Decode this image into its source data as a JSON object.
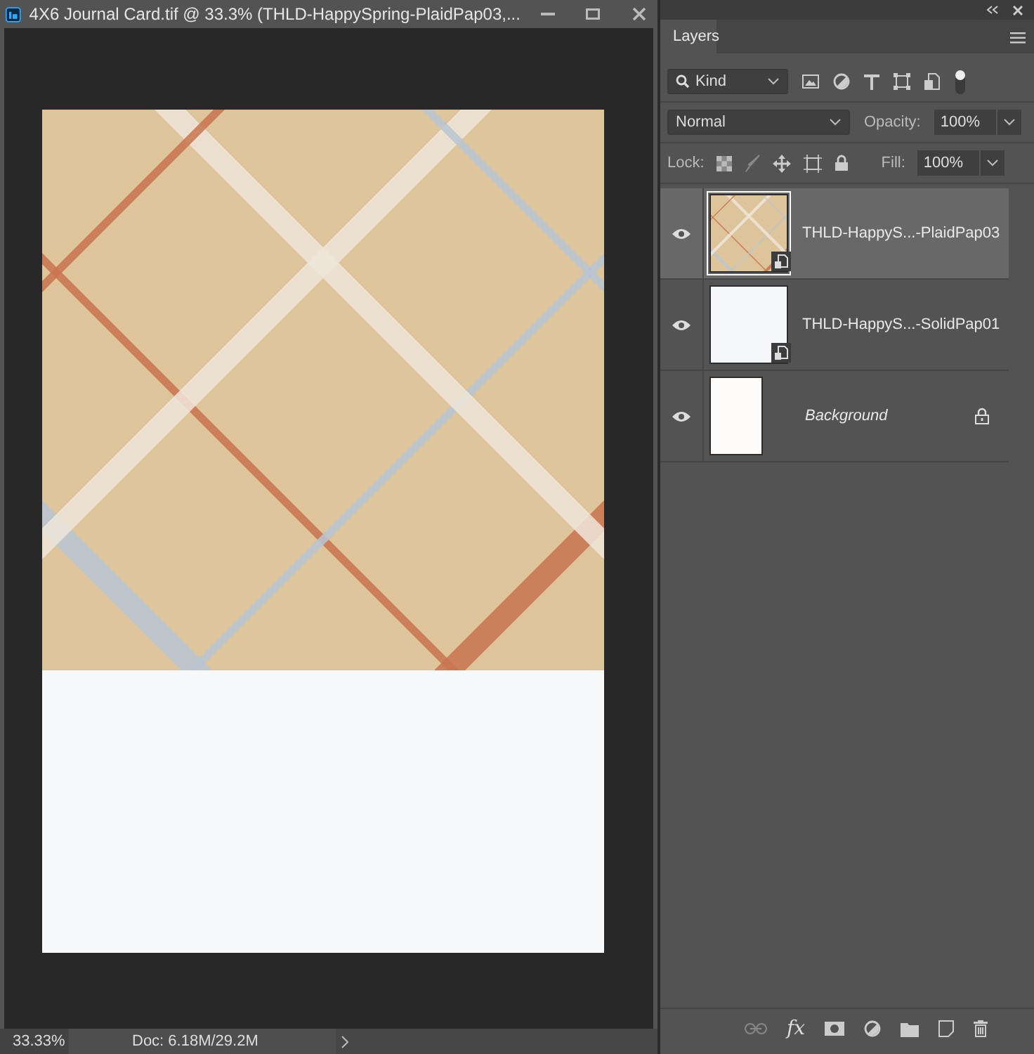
{
  "document": {
    "title": "4X6 Journal Card.tif @ 33.3% (THLD-HappySpring-PlaidPap03,...",
    "zoom": "33.33%",
    "doc_info": "Doc: 6.18M/29.2M"
  },
  "layers_panel": {
    "tab": "Layers",
    "filter": "Kind",
    "filter_on": true,
    "blend_mode": "Normal",
    "opacity_label": "Opacity:",
    "opacity": "100%",
    "lock_label": "Lock:",
    "fill_label": "Fill:",
    "fill": "100%",
    "layers": [
      {
        "name": "THLD-HappyS...-PlaidPap03",
        "kind": "smart",
        "selected": true,
        "visible": true
      },
      {
        "name": "THLD-HappyS...-SolidPap01",
        "kind": "smart",
        "thumbnail": {
          "kind": "blank"
        },
        "selected": false,
        "visible": true
      },
      {
        "name": "Background",
        "kind": "background",
        "thumbnail": {
          "kind": "blank"
        },
        "selected": false,
        "visible": true
      }
    ],
    "footer_fx": "fx"
  }
}
